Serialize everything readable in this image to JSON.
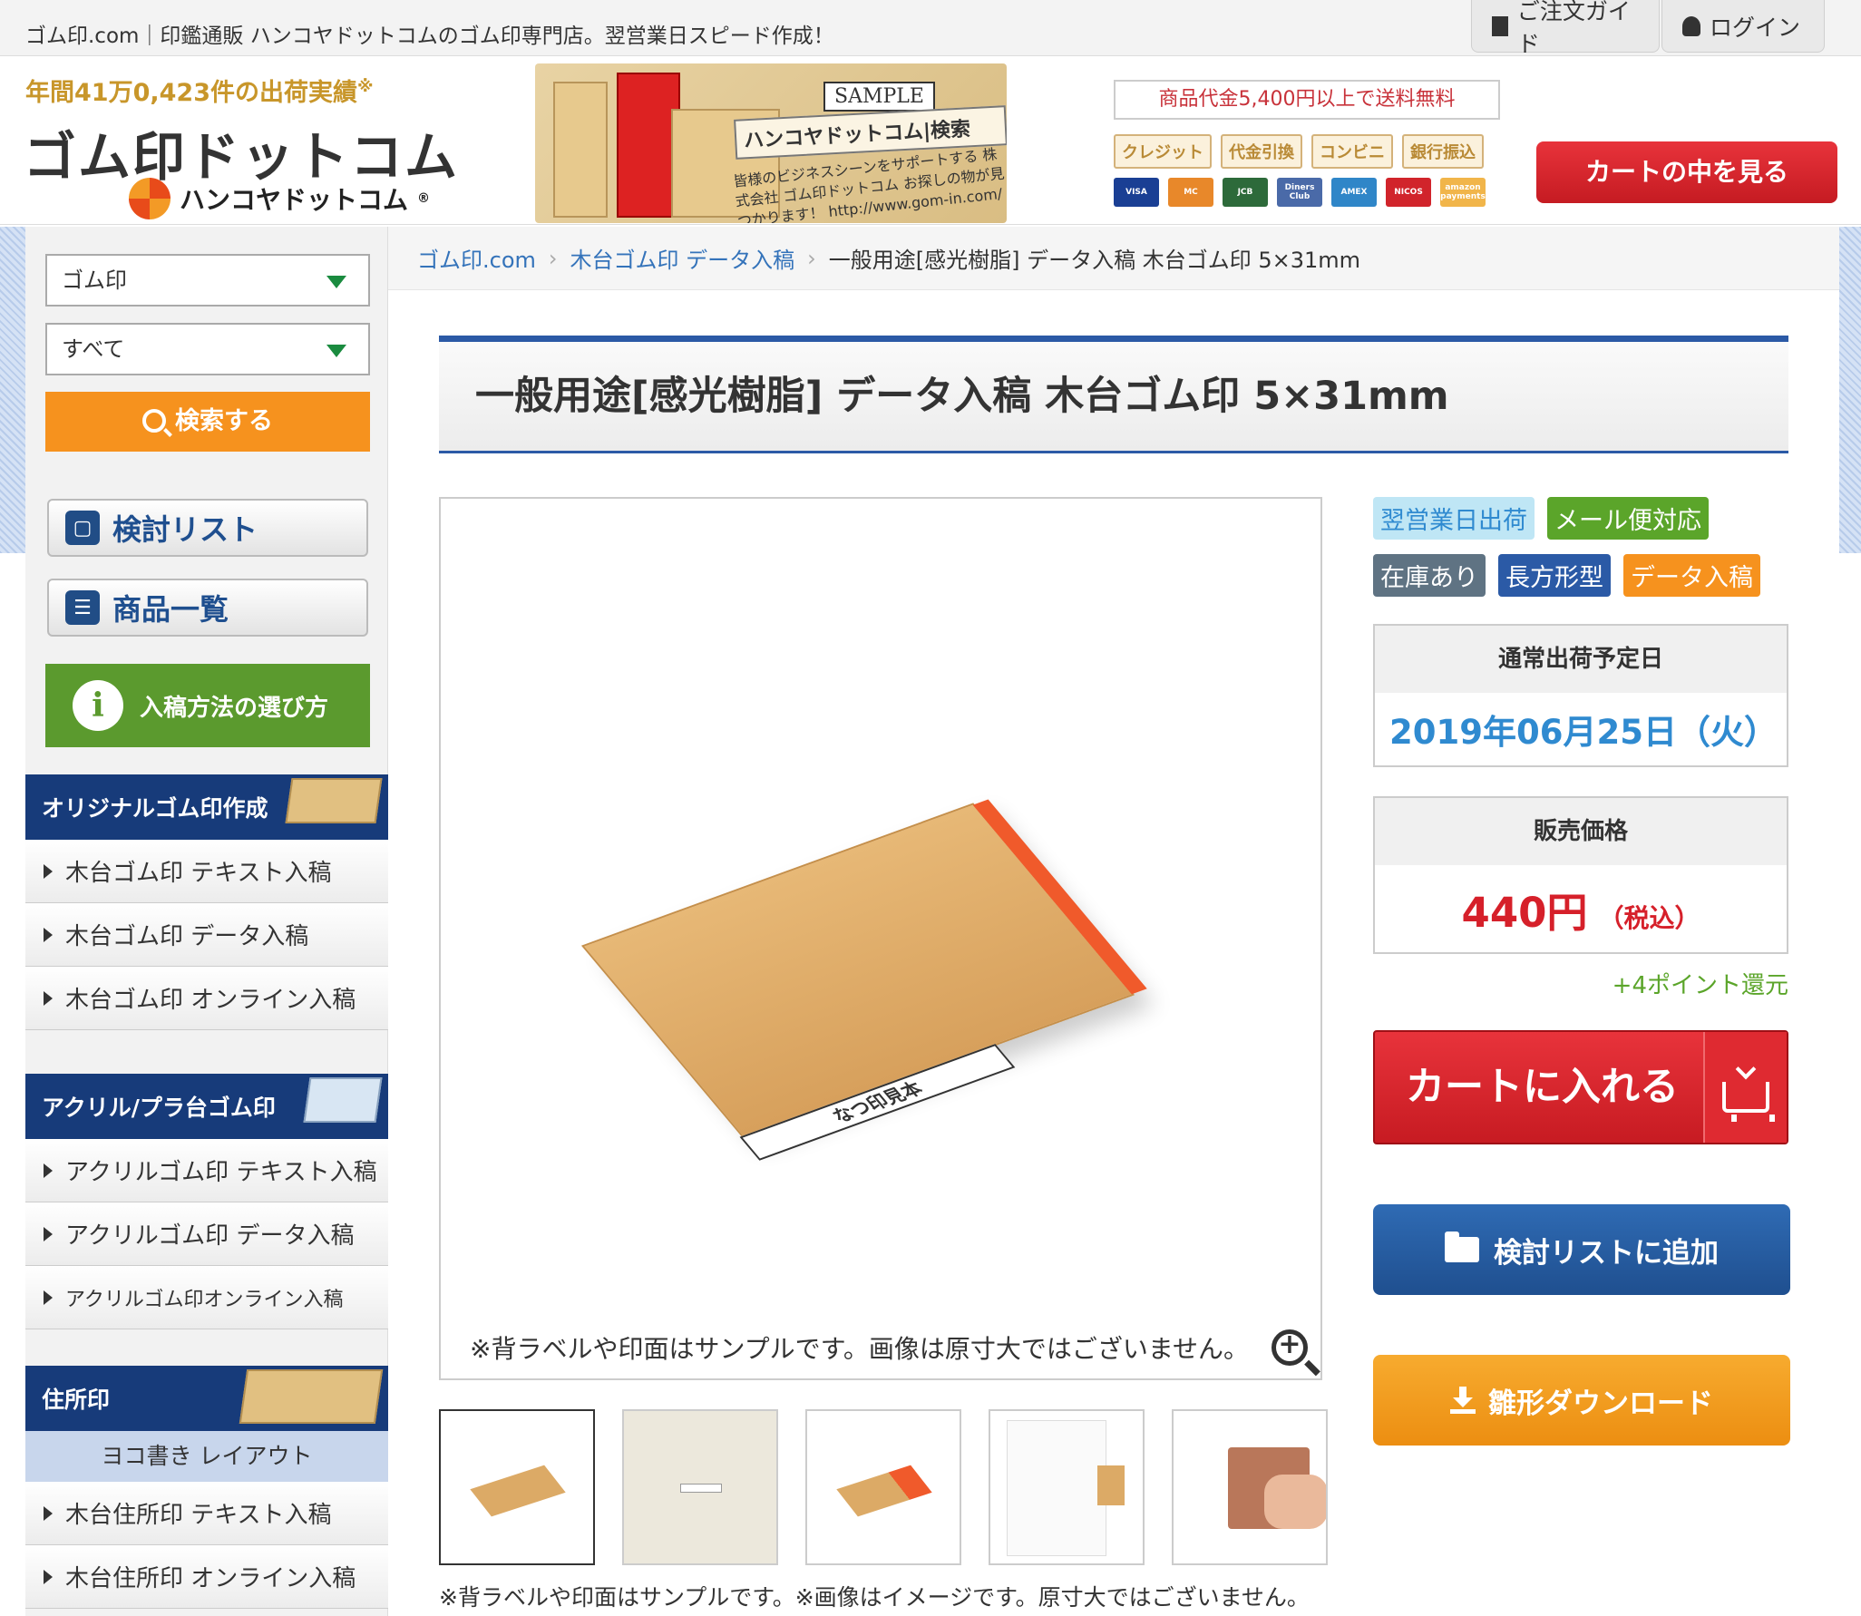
{
  "topbar": {
    "tagline": "ゴム印.com｜印鑑通販 ハンコヤドットコムのゴム印専門店。翌営業日スピード作成！",
    "order_guide": "ご注文ガイド",
    "login": "ログイン"
  },
  "header": {
    "ship_count": "年間41万0,423件の出荷実績",
    "ship_mark": "※",
    "logo_main": "ゴム印ドットコム",
    "logo_sub": "ハンコヤドットコム",
    "logo_reg": "®",
    "banner": {
      "sample": "SAMPLE",
      "stamp_text": "ハンコヤドットコム|検索",
      "block_text": "皆様のビジネスシーンをサポートする 株式会社 ゴム印ドットコム お探しの物が見つかります！ http://www.gom-in.com/"
    },
    "free_shipping": "商品代金5,400円以上で送料無料",
    "payments": [
      "クレジット",
      "代金引換",
      "コンビニ",
      "銀行振込"
    ],
    "cards": [
      {
        "name": "VISA",
        "color": "#1a3f94"
      },
      {
        "name": "MC",
        "color": "#e8882a"
      },
      {
        "name": "JCB",
        "color": "#2d6a3a"
      },
      {
        "name": "Diners Club",
        "color": "#4a6aa8"
      },
      {
        "name": "AMEX",
        "color": "#2f86c8"
      },
      {
        "name": "NICOS",
        "color": "#d1242b"
      },
      {
        "name": "amazon payments",
        "color": "#f1b54a"
      }
    ],
    "cart_button": "カートの中を見る"
  },
  "sidebar": {
    "select_category": "ゴム印",
    "select_sub": "すべて",
    "search_button": "検索する",
    "review_list": "検討リスト",
    "product_list": "商品一覧",
    "input_guide": "入稿方法の選び方",
    "sections": [
      {
        "title": "オリジナルゴム印作成",
        "items": [
          "木台ゴム印 テキスト入稿",
          "木台ゴム印 データ入稿",
          "木台ゴム印 オンライン入稿"
        ]
      },
      {
        "title": "アクリル/プラ台ゴム印",
        "items": [
          "アクリルゴム印 テキスト入稿",
          "アクリルゴム印 データ入稿",
          "アクリルゴム印オンライン入稿"
        ]
      },
      {
        "title": "住所印",
        "subtitle": "ヨコ書き レイアウト",
        "items": [
          "木台住所印 テキスト入稿",
          "木台住所印 オンライン入稿"
        ]
      }
    ]
  },
  "breadcrumb": {
    "home": "ゴム印.com",
    "category": "木台ゴム印 データ入稿",
    "current": "一般用途[感光樹脂] データ入稿 木台ゴム印 5×31mm"
  },
  "product": {
    "title": "一般用途[感光樹脂] データ入稿 木台ゴム印 5×31mm",
    "stamp_label": "なつ印見本",
    "image_caption": "※背ラベルや印面はサンプルです。画像は原寸大ではございません。",
    "thumb_caption": "※背ラベルや印面はサンプルです。※画像はイメージです。原寸大ではございません。",
    "badges": [
      {
        "label": "翌営業日出荷",
        "bg": "#bfe6f5",
        "fg": "#2f8ad0"
      },
      {
        "label": "メール便対応",
        "bg": "#5ba52a",
        "fg": "#ffffff"
      },
      {
        "label": "在庫あり",
        "bg": "#5f7383",
        "fg": "#ffffff"
      },
      {
        "label": "長方形型",
        "bg": "#2b5aa6",
        "fg": "#ffffff"
      },
      {
        "label": "データ入稿",
        "bg": "#f6921e",
        "fg": "#ffffff"
      }
    ],
    "ship_date_label": "通常出荷予定日",
    "ship_date": "2019年06月25日（火）",
    "price_label": "販売価格",
    "price": "440円",
    "tax": "（税込）",
    "points": "+4ポイント還元",
    "add_to_cart": "カートに入れる",
    "add_to_list": "検討リストに追加",
    "download": "雛形ダウンロード"
  },
  "colors": {
    "brand_blue": "#173b7a",
    "accent_red": "#d6202a",
    "accent_orange": "#f6921e",
    "accent_green": "#5b9a2e"
  }
}
